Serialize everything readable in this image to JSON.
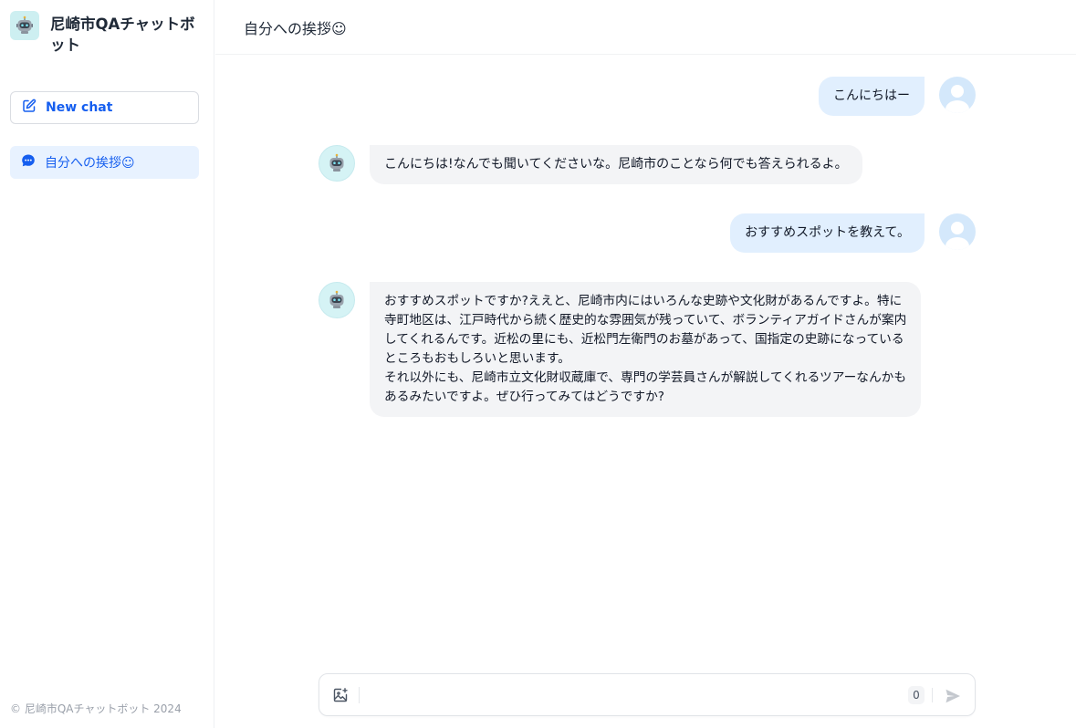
{
  "app": {
    "title": "尼崎市QAチャットボット",
    "footer": "© 尼崎市QAチャットボット 2024"
  },
  "sidebar": {
    "new_chat_label": "New chat",
    "conversations": [
      {
        "label": "自分への挨拶☺",
        "active": true
      }
    ]
  },
  "header": {
    "title": "自分への挨拶☺"
  },
  "messages": [
    {
      "role": "user",
      "lines": [
        "こんにちはー"
      ]
    },
    {
      "role": "bot",
      "lines": [
        "こんにちは!なんでも聞いてくださいな。尼崎市のことなら何でも答えられるよ。"
      ]
    },
    {
      "role": "user",
      "lines": [
        "おすすめスポットを教えて。"
      ]
    },
    {
      "role": "bot",
      "lines": [
        "おすすめスポットですか?ええと、尼崎市内にはいろんな史跡や文化財があるんですよ。特に",
        "寺町地区は、江戸時代から続く歴史的な雰囲気が残っていて、ボランティアガイドさんが案内",
        "してくれるんです。近松の里にも、近松門左衛門のお墓があって、国指定の史跡になっている",
        "ところもおもしろいと思います。",
        "それ以外にも、尼崎市立文化財収蔵庫で、専門の学芸員さんが解説してくれるツアーなんかも",
        "あるみたいですよ。ぜひ行ってみてはどうですか?"
      ]
    }
  ],
  "composer": {
    "value": "",
    "char_count": "0"
  },
  "icons": {
    "brand": "robot-icon",
    "new_chat": "edit-icon",
    "conversation": "chat-bubble-icon",
    "image_upload": "image-plus-icon",
    "send": "send-icon"
  },
  "colors": {
    "accent": "#155eef",
    "active_item_bg": "#e8f2ff",
    "user_bubble": "#e1effe",
    "bot_bubble": "#f3f4f6"
  }
}
